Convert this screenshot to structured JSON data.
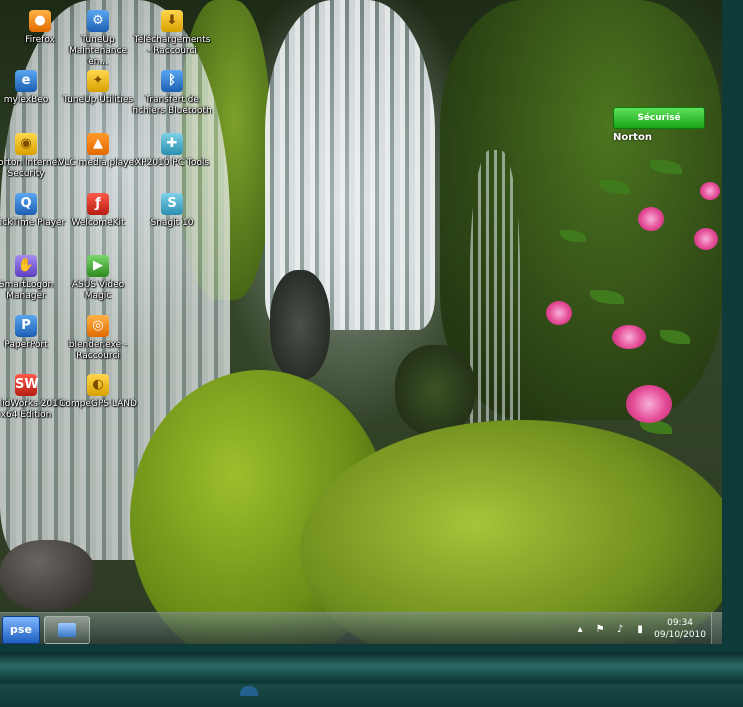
{
  "desktop": {
    "icons": [
      {
        "label": "Firefox",
        "icon": "firefox-icon"
      },
      {
        "label": "TuneUp Maintenance en...",
        "icon": "tuneup-maintenance-icon"
      },
      {
        "label": "Téléchargements - Raccourci",
        "icon": "downloads-folder-icon"
      },
      {
        "label": "mylexBeo",
        "icon": "ie-icon"
      },
      {
        "label": "TuneUp Utilities",
        "icon": "tuneup-utilities-icon"
      },
      {
        "label": "Transfert de fichiers Bluetooth",
        "icon": "bluetooth-icon"
      },
      {
        "label": "Norton Internet Security",
        "icon": "norton-globe-icon"
      },
      {
        "label": "VLC media player",
        "icon": "vlc-cone-icon"
      },
      {
        "label": "XP2010 PC Tools",
        "icon": "xp-tools-icon"
      },
      {
        "label": "QuickTime Player",
        "icon": "quicktime-icon"
      },
      {
        "label": "WelcomeKit",
        "icon": "flash-icon"
      },
      {
        "label": "Snagit 10",
        "icon": "snagit-icon"
      },
      {
        "label": "SmartLogon Manager",
        "icon": "smartlogon-icon"
      },
      {
        "label": "ASUS Video Magic",
        "icon": "asus-video-icon"
      },
      {
        "label": "PaperPort",
        "icon": "paperport-icon"
      },
      {
        "label": "blender.exe - Raccourci",
        "icon": "blender-icon"
      },
      {
        "label": "SolidWorks 2010 x64 Edition",
        "icon": "solidworks-icon"
      },
      {
        "label": "CompeGPS LAND",
        "icon": "compegps-icon"
      }
    ]
  },
  "norton_widget": {
    "status": "Sécurisé",
    "brand": "Norton"
  },
  "taskbar": {
    "start_label": "pse",
    "tray": {
      "time": "09:34",
      "date": "09/10/2010",
      "icons": [
        "show-hidden-icons-icon",
        "flag-icon",
        "volume-icon",
        "power-icon"
      ]
    }
  }
}
